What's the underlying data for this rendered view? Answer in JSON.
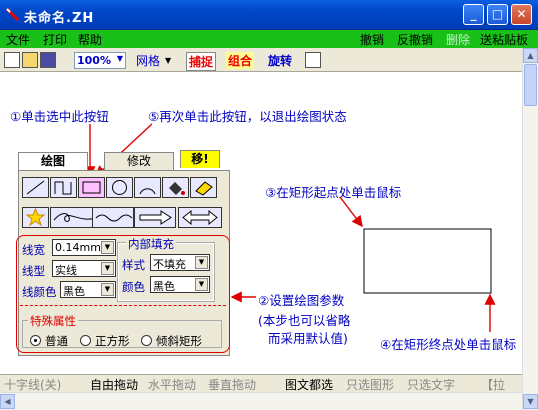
{
  "window": {
    "title": "未命名.ZH"
  },
  "menu": {
    "left": [
      "文件",
      "打印",
      "帮助"
    ],
    "right": [
      "撤销",
      "反撤销",
      "删除",
      "送粘贴板"
    ]
  },
  "toolbar": {
    "zoom": "100%",
    "grid": "网格",
    "snap": "捕捉",
    "combine": "组合",
    "rotate": "旋转"
  },
  "notes": {
    "step1": "①单击选中此按钮",
    "step5": "⑤再次单击此按钮，以退出绘图状态",
    "step3": "③在矩形起点处单击鼠标",
    "step2_line1": "②设置绘图参数",
    "step2_line2": "(本步也可以省略",
    "step2_line3": "而采用默认值)",
    "step4": "④在矩形终点处单击鼠标"
  },
  "panel": {
    "tabs": [
      "绘图",
      "修改",
      "移!"
    ],
    "line_width_label": "线宽",
    "line_width": "0.14mm",
    "line_type_label": "线型",
    "line_type": "实线",
    "line_color_label": "线颜色",
    "line_color": "黑色",
    "fill_group": "内部填充",
    "fill_style_label": "样式",
    "fill_style": "不填充",
    "fill_color_label": "颜色",
    "fill_color": "黑色",
    "special_group": "特殊属性",
    "radio_normal": "普通",
    "radio_square": "正方形",
    "radio_tilted": "倾斜矩形"
  },
  "status": [
    "十字线(关)",
    "自由拖动",
    "水平拖动",
    "垂直拖动",
    "图文都选",
    "只选图形",
    "只选文字",
    "【拉"
  ],
  "colors": {
    "menu_green": "#18c018",
    "annotation_red": "#e00000",
    "note_blue": "#0000c0"
  }
}
